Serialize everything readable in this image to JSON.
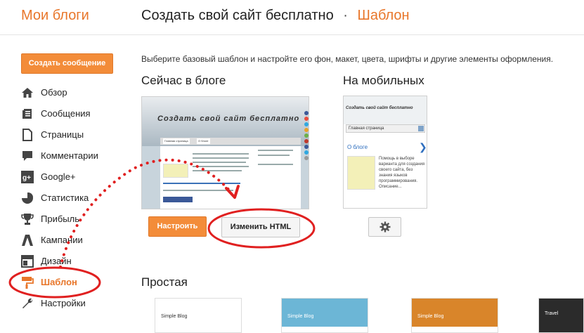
{
  "header": {
    "brand": "Мои блоги",
    "title": "Создать свой сайт бесплатно",
    "separator": "·",
    "section": "Шаблон"
  },
  "sidebar": {
    "create_button": "Создать сообщение",
    "items": [
      {
        "label": "Обзор",
        "icon": "home-icon"
      },
      {
        "label": "Сообщения",
        "icon": "posts-icon"
      },
      {
        "label": "Страницы",
        "icon": "pages-icon"
      },
      {
        "label": "Комментарии",
        "icon": "comments-icon"
      },
      {
        "label": "Google+",
        "icon": "google-plus-icon"
      },
      {
        "label": "Статистика",
        "icon": "stats-pie-icon"
      },
      {
        "label": "Прибыль",
        "icon": "trophy-icon"
      },
      {
        "label": "Кампании",
        "icon": "adwords-icon"
      },
      {
        "label": "Дизайн",
        "icon": "layout-icon"
      },
      {
        "label": "Шаблон",
        "icon": "paint-roller-icon",
        "active": true
      },
      {
        "label": "Настройки",
        "icon": "wrench-icon"
      }
    ]
  },
  "main": {
    "description": "Выберите базовый шаблон и настройте его фон, макет, цвета, шрифты и другие элементы оформления.",
    "current_title": "Сейчас в блоге",
    "mobile_title": "На мобильных",
    "configure_button": "Настроить",
    "edit_html_button": "Изменить HTML",
    "simple_title": "Простая"
  },
  "preview_desktop": {
    "blog_title": "Создать свой сайт бесплатно",
    "tab_home": "Главная страница",
    "tab_about": "О блоге"
  },
  "preview_mobile": {
    "blog_title": "Создать свой сайт бесплатно",
    "nav_select": "Главная страница",
    "link": "О блоге",
    "text": "Помощь в выборе варианта для создания своего сайта, без знания языков программирования. Описание..."
  },
  "templates": [
    {
      "name": "Simple Blog",
      "color": "#ffffff",
      "text_color": "#333333"
    },
    {
      "name": "Simple Blog",
      "color": "#6cb6d6",
      "text_color": "#ffffff"
    },
    {
      "name": "Simple Blog",
      "color": "#d9852a",
      "text_color": "#ffffff"
    },
    {
      "name": "Travel",
      "color": "#2b2b2b",
      "text_color": "#ffffff"
    }
  ],
  "colors": {
    "accent": "#e8762a",
    "button_orange": "#f38c39",
    "annotation_red": "#e02020"
  }
}
